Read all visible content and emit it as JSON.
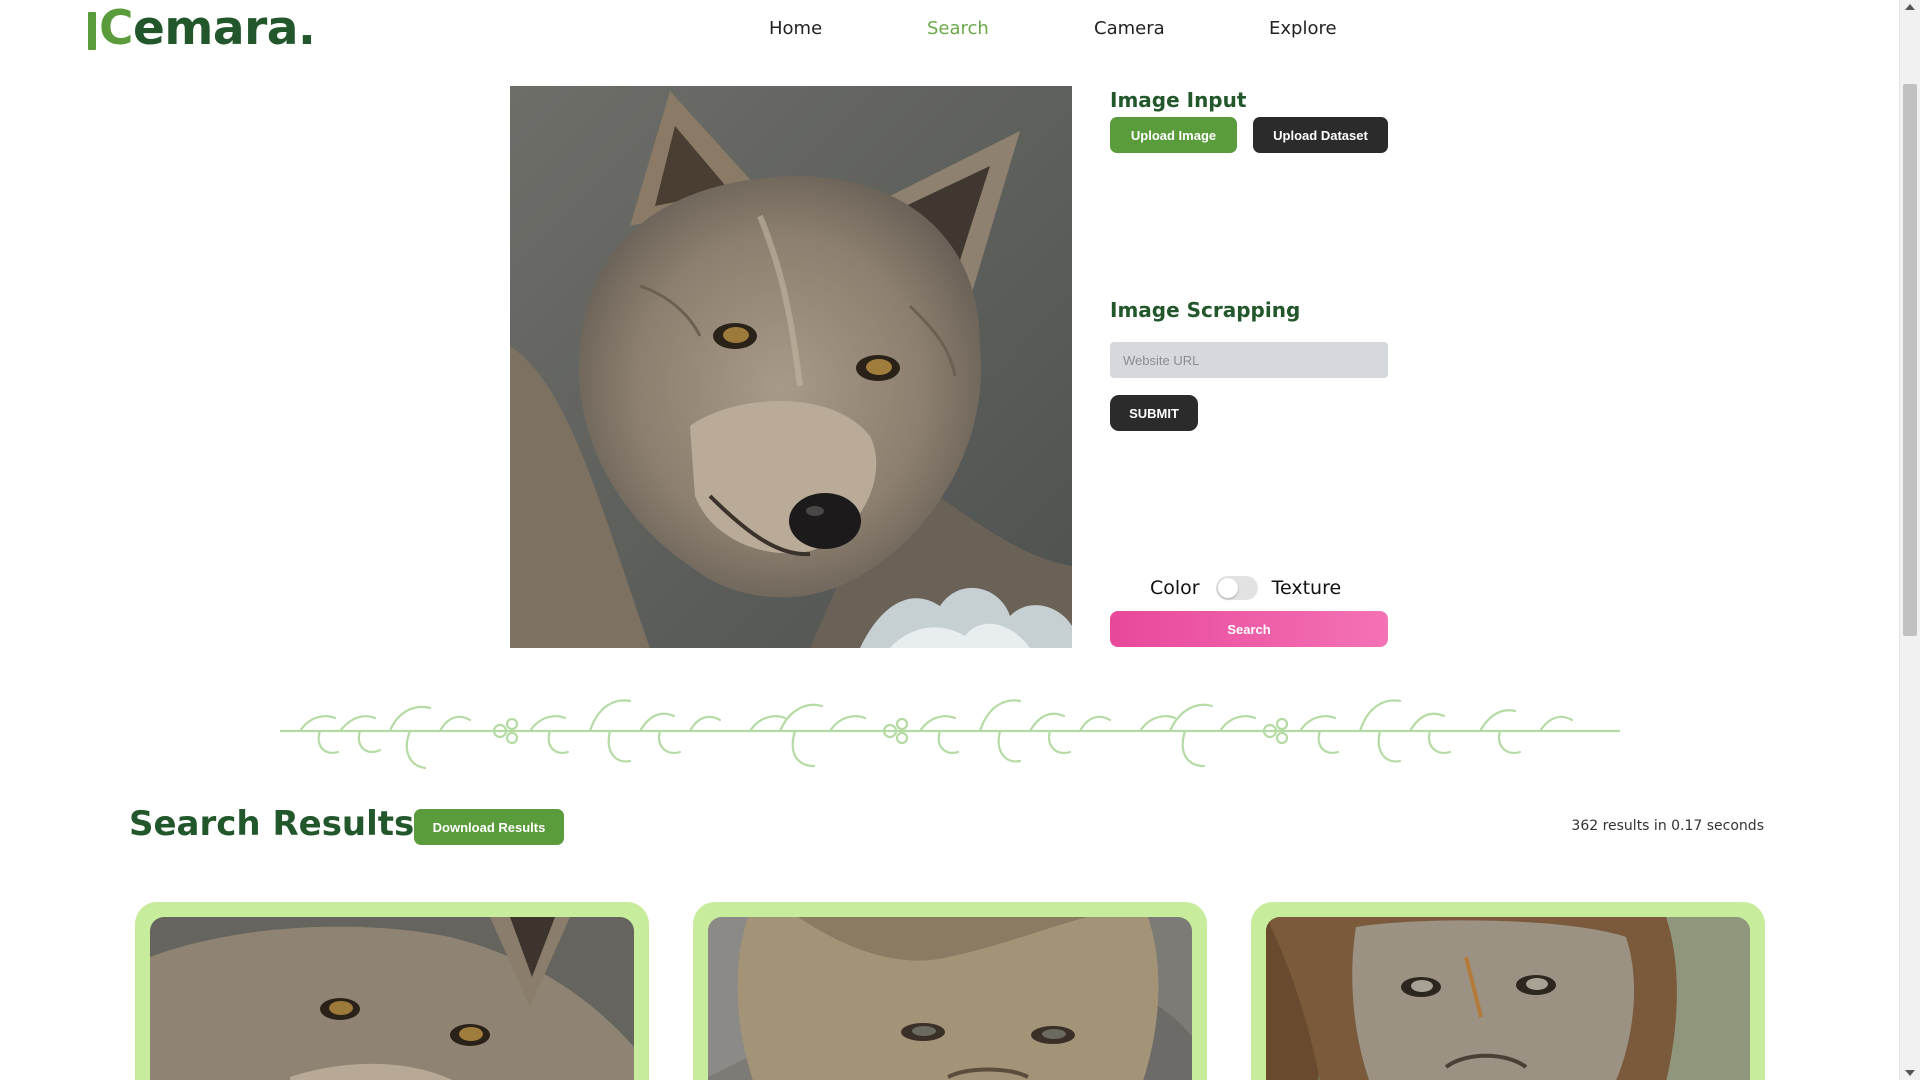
{
  "app": {
    "logo_text_c": "C",
    "logo_text_rest": "emara.",
    "logo_color": "#22572b",
    "logo_accent": "#5a9b3c"
  },
  "nav": {
    "items": [
      {
        "label": "Home",
        "active": false
      },
      {
        "label": "Search",
        "active": true
      },
      {
        "label": "Camera",
        "active": false
      },
      {
        "label": "Explore",
        "active": false
      }
    ],
    "active_color": "#6aa849"
  },
  "query": {
    "image_icon": "wolf-photo"
  },
  "image_input": {
    "title": "Image Input",
    "upload_image_label": "Upload Image",
    "upload_dataset_label": "Upload Dataset"
  },
  "scraping": {
    "title": "Image Scrapping",
    "url_placeholder": "Website URL",
    "url_value": "",
    "submit_label": "SUBMIT"
  },
  "mode": {
    "left_label": "Color",
    "right_label": "Texture",
    "texture_enabled": false
  },
  "search_button_label": "Search",
  "results": {
    "title": "Search Results",
    "download_label": "Download Results",
    "stats": "362 results in 0.17 seconds",
    "cards": [
      {
        "image_icon": "wolf-photo"
      },
      {
        "image_icon": "lion-cub-photo"
      },
      {
        "image_icon": "lion-photo"
      }
    ]
  },
  "colors": {
    "primary_green": "#5a9b3c",
    "dark_green": "#22572b",
    "dark_button": "#2b2b2b",
    "search_pink_start": "#e8489a",
    "search_pink_end": "#f472b6",
    "card_bg": "#c6ec9c",
    "divider": "#b5dba4"
  }
}
